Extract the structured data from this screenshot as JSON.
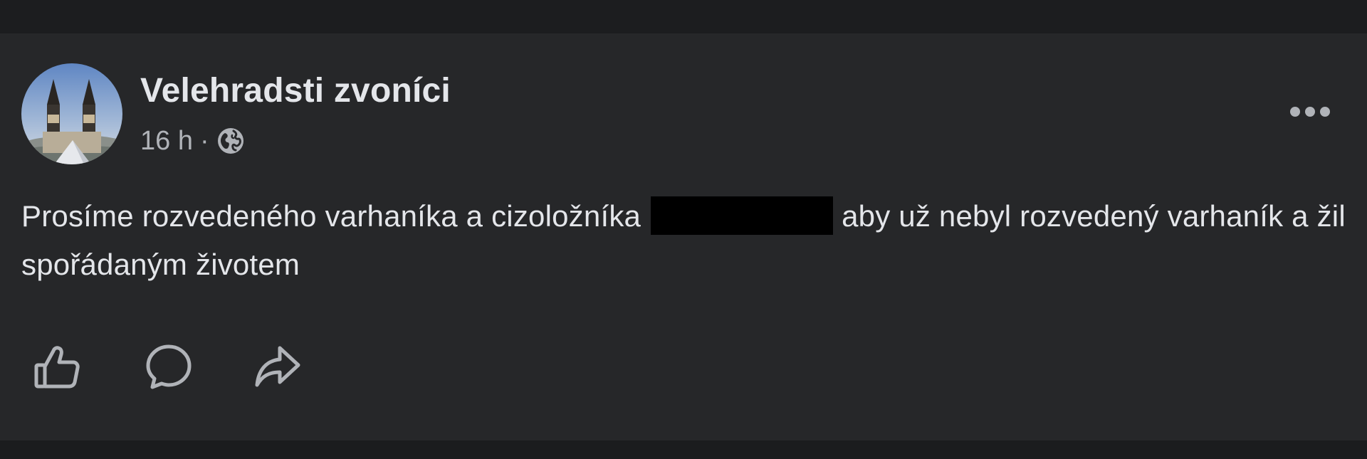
{
  "colors": {
    "page_background": "#1c1d1f",
    "card_background": "#262729",
    "primary_text": "#e4e6ea",
    "secondary_text": "#b0b3b8",
    "icon_color": "#b0b3b8",
    "redaction": "#000000"
  },
  "post": {
    "author": "Velehradsti zvoníci",
    "time": "16 h",
    "separator": "·",
    "audience_icon": "globe-icon",
    "more_icon": "more-options-icon",
    "text_before_redaction": "Prosíme rozvedeného varhaníka a cizoložníka",
    "text_after_redaction": "aby už nebyl rozvedený varhaník a žil spořádaným životem"
  },
  "actions": [
    {
      "icon": "like-icon"
    },
    {
      "icon": "comment-icon"
    },
    {
      "icon": "share-icon"
    }
  ]
}
